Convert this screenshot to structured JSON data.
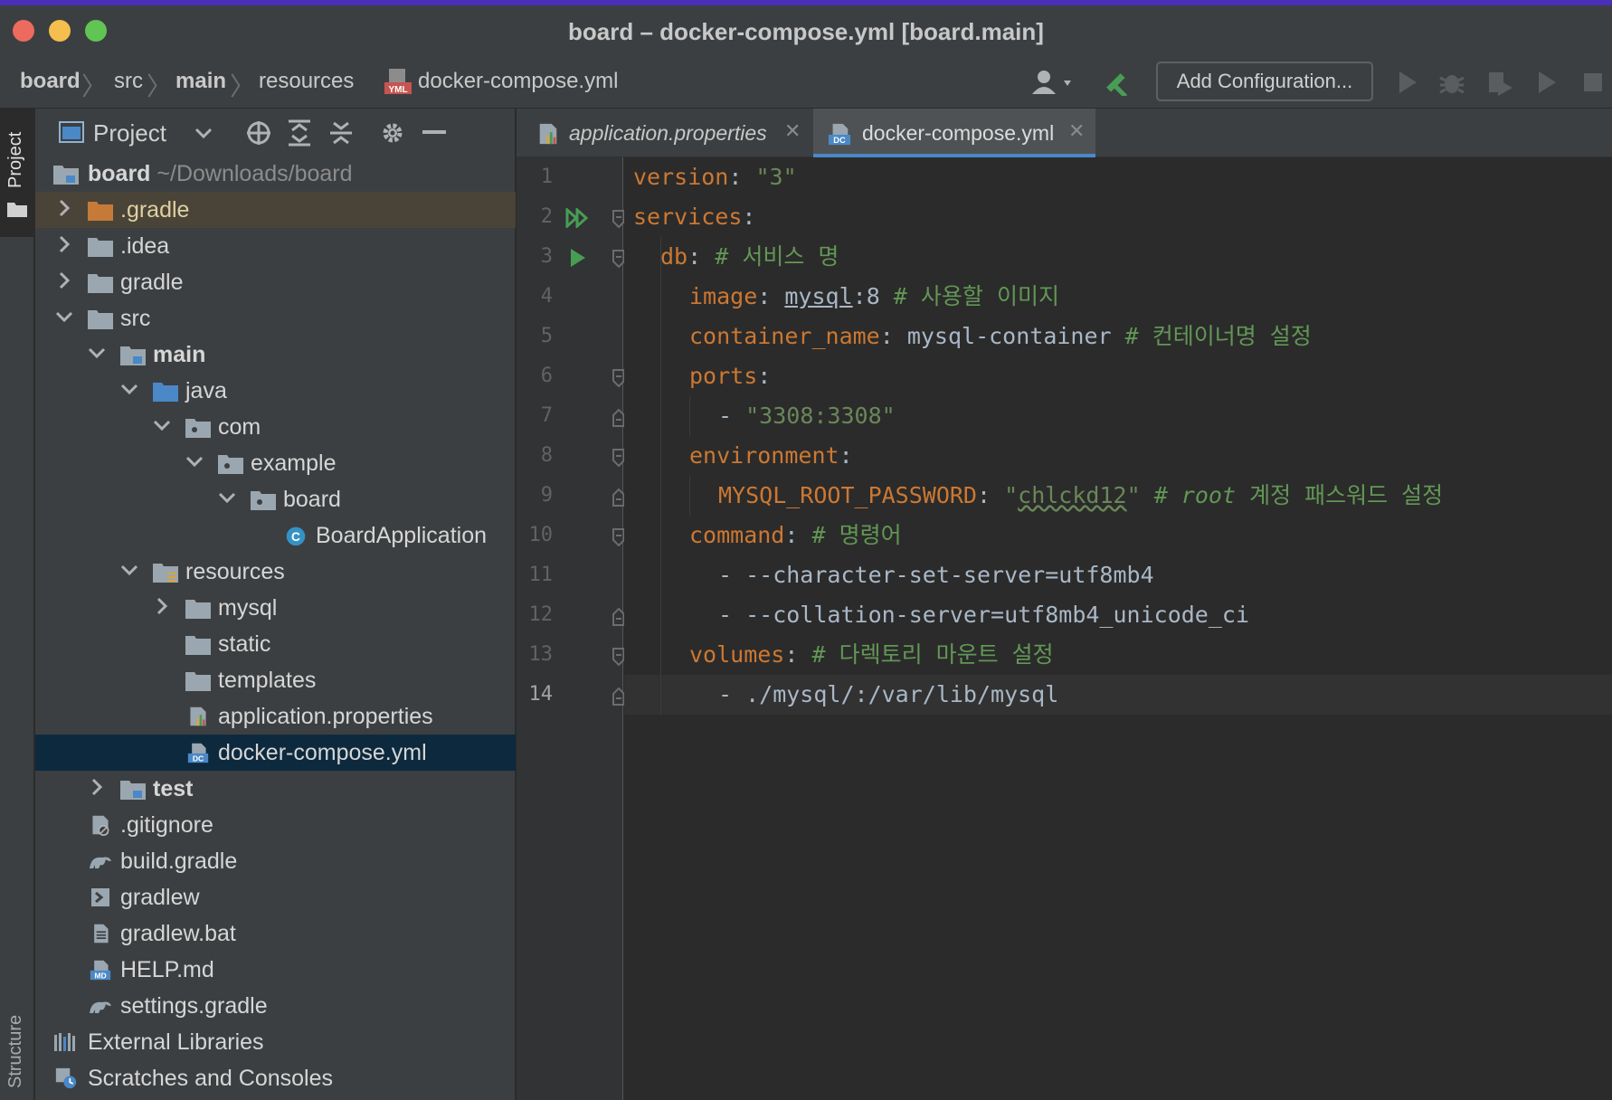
{
  "window": {
    "title": "board – docker-compose.yml [board.main]"
  },
  "breadcrumbs": [
    "board",
    "src",
    "main",
    "resources",
    "docker-compose.yml"
  ],
  "toolbar": {
    "add_configuration": "Add Configuration..."
  },
  "side_strip": {
    "project_label": "Project",
    "structure_label": "Structure"
  },
  "project_panel": {
    "title": "Project",
    "root_name": "board",
    "root_path": "~/Downloads/board",
    "tree": [
      {
        "label": ".gradle"
      },
      {
        "label": ".idea"
      },
      {
        "label": "gradle"
      },
      {
        "label": "src"
      },
      {
        "label": "main"
      },
      {
        "label": "java"
      },
      {
        "label": "com"
      },
      {
        "label": "example"
      },
      {
        "label": "board"
      },
      {
        "label": "BoardApplication"
      },
      {
        "label": "resources"
      },
      {
        "label": "mysql"
      },
      {
        "label": "static"
      },
      {
        "label": "templates"
      },
      {
        "label": "application.properties"
      },
      {
        "label": "docker-compose.yml"
      },
      {
        "label": "test"
      },
      {
        "label": ".gitignore"
      },
      {
        "label": "build.gradle"
      },
      {
        "label": "gradlew"
      },
      {
        "label": "gradlew.bat"
      },
      {
        "label": "HELP.md"
      },
      {
        "label": "settings.gradle"
      },
      {
        "label": "External Libraries"
      },
      {
        "label": "Scratches and Consoles"
      }
    ]
  },
  "editor": {
    "tabs": [
      {
        "label": "application.properties",
        "active": false
      },
      {
        "label": "docker-compose.yml",
        "active": true
      }
    ],
    "current_line": 14,
    "line_numbers": [
      "1",
      "2",
      "3",
      "4",
      "5",
      "6",
      "7",
      "8",
      "9",
      "10",
      "11",
      "12",
      "13",
      "14"
    ],
    "lines": {
      "l1": {
        "k": "version",
        "p": ": ",
        "s": "\"3\""
      },
      "l2": {
        "k": "services",
        "p": ":"
      },
      "l3": {
        "k": "db",
        "p": ": ",
        "c": "# 서비스 명"
      },
      "l4": {
        "k": "image",
        "p": ": ",
        "u": "mysql",
        "p2": ":8 ",
        "c": "# 사용할 이미지"
      },
      "l5": {
        "k": "container_name",
        "p": ": mysql-container ",
        "c": "# 컨테이너명 설정"
      },
      "l6": {
        "k": "ports",
        "p": ":"
      },
      "l7": {
        "p": "- ",
        "s": "\"3308:3308\""
      },
      "l8": {
        "k": "environment",
        "p": ":"
      },
      "l9": {
        "k": "MYSQL_ROOT_PASSWORD",
        "p": ": ",
        "s1": "\"",
        "sw": "chlckd12",
        "s2": "\" ",
        "c1": "# ",
        "ci": "root",
        "c2": " 계정 패스워드 설정"
      },
      "l10": {
        "k": "command",
        "p": ": ",
        "c": "# 명령어"
      },
      "l11": {
        "p": "- --character-set-server=utf8mb4"
      },
      "l12": {
        "p": "- --collation-server=utf8mb4_unicode_ci"
      },
      "l13": {
        "k": "volumes",
        "p": ": ",
        "c": "# 다렉토리 마운트 설정"
      },
      "l14": {
        "p": "- ./mysql/:/var/lib/mysql"
      }
    }
  },
  "colors": {
    "yaml_key": "#cc7832",
    "yaml_string": "#6a8759",
    "yaml_comment": "#629755",
    "selection": "#0d293e",
    "tab_underline": "#4a88c7"
  }
}
